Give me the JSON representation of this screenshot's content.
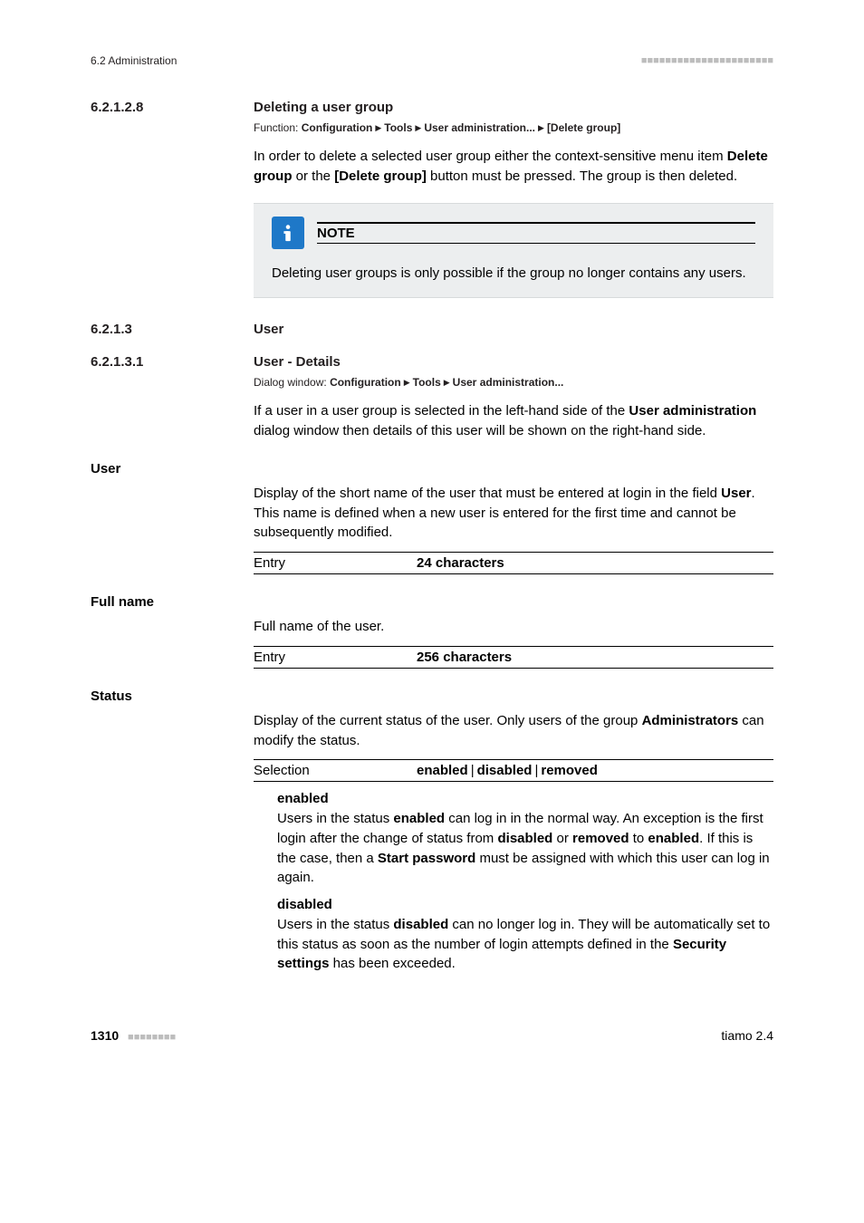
{
  "header": {
    "left": "6.2 Administration",
    "bars": "■■■■■■■■■■■■■■■■■■■■■■"
  },
  "s6_2_1_2_8": {
    "num": "6.2.1.2.8",
    "title": "Deleting a user group",
    "func_prefix": "Function:",
    "func_parts": [
      "Configuration",
      "Tools",
      "User administration...",
      "[Delete group]"
    ],
    "para_parts": [
      "In order to delete a selected user group either the context-sensitive menu item ",
      "Delete group",
      " or the ",
      "[Delete group]",
      " button must be pressed. The group is then deleted."
    ],
    "note_title": "NOTE",
    "note_body": "Deleting user groups is only possible if the group no longer contains any users."
  },
  "s6_2_1_3": {
    "num": "6.2.1.3",
    "title": "User"
  },
  "s6_2_1_3_1": {
    "num": "6.2.1.3.1",
    "title": "User - Details",
    "dlg_prefix": "Dialog window:",
    "dlg_parts": [
      "Configuration",
      "Tools",
      "User administration..."
    ],
    "intro_parts": [
      "If a user in a user group is selected in the left-hand side of the ",
      "User administration",
      " dialog window then details of this user will be shown on the right-hand side."
    ]
  },
  "user_field": {
    "heading": "User",
    "para_parts": [
      "Display of the short name of the user that must be entered at login in the field ",
      "User",
      ". This name is defined when a new user is entered for the first time and cannot be subsequently modified."
    ],
    "entry_label": "Entry",
    "entry_value": "24 characters"
  },
  "fullname_field": {
    "heading": "Full name",
    "para": "Full name of the user.",
    "entry_label": "Entry",
    "entry_value": "256 characters"
  },
  "status_field": {
    "heading": "Status",
    "para_parts": [
      "Display of the current status of the user. Only users of the group ",
      "Administrators",
      " can modify the status."
    ],
    "sel_label": "Selection",
    "sel_options": [
      "enabled",
      "disabled",
      "removed"
    ],
    "items": [
      {
        "name": "enabled",
        "body_parts": [
          "Users in the status ",
          "enabled",
          " can log in in the normal way. An exception is the first login after the change of status from ",
          "disabled",
          " or ",
          "removed",
          " to ",
          "enabled",
          ". If this is the case, then a ",
          "Start password",
          " must be assigned with which this user can log in again."
        ]
      },
      {
        "name": "disabled",
        "body_parts": [
          "Users in the status ",
          "disabled",
          " can no longer log in. They will be automatically set to this status as soon as the number of login attempts defined in the ",
          "Security settings",
          " has been exceeded."
        ]
      }
    ]
  },
  "footer": {
    "page": "1310",
    "bars": "■■■■■■■■",
    "product": "tiamo 2.4"
  }
}
